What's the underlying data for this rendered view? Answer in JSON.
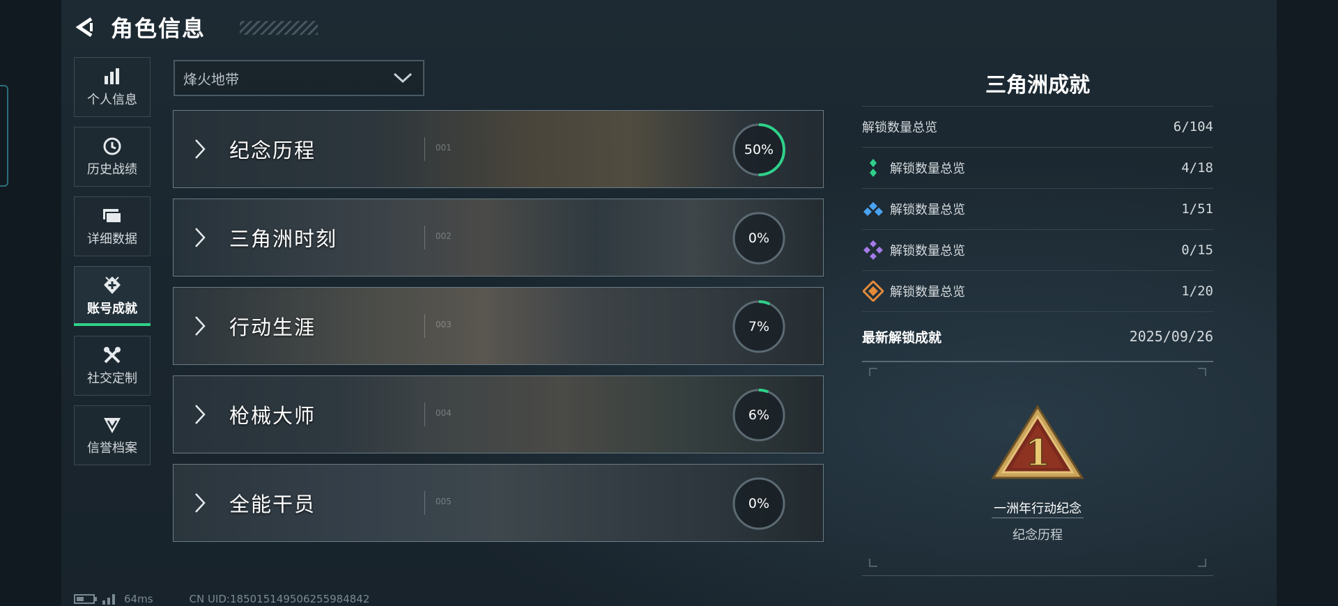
{
  "header": {
    "title": "角色信息"
  },
  "nav": [
    {
      "id": "personal",
      "label": "个人信息",
      "icon": "bar-chart-icon",
      "active": false
    },
    {
      "id": "history",
      "label": "历史战绩",
      "icon": "history-icon",
      "active": false
    },
    {
      "id": "details",
      "label": "详细数据",
      "icon": "folder-icon",
      "active": false
    },
    {
      "id": "achievements",
      "label": "账号成就",
      "icon": "achievement-icon",
      "active": true
    },
    {
      "id": "social",
      "label": "社交定制",
      "icon": "tools-icon",
      "active": false
    },
    {
      "id": "credit",
      "label": "信誉档案",
      "icon": "shield-icon",
      "active": false
    }
  ],
  "mode_select": {
    "value": "烽火地带"
  },
  "categories": [
    {
      "name": "纪念历程",
      "number": "001",
      "percent": "50%",
      "progress": 0.5
    },
    {
      "name": "三角洲时刻",
      "number": "002",
      "percent": "0%",
      "progress": 0
    },
    {
      "name": "行动生涯",
      "number": "003",
      "percent": "7%",
      "progress": 0.07
    },
    {
      "name": "枪械大师",
      "number": "004",
      "percent": "6%",
      "progress": 0.06
    },
    {
      "name": "全能干员",
      "number": "005",
      "percent": "0%",
      "progress": 0
    }
  ],
  "panel": {
    "title": "三角洲成就",
    "total": {
      "label": "解锁数量总览",
      "count": "6/104"
    },
    "tiers": [
      {
        "label": "解锁数量总览",
        "count": "4/18",
        "color": "#2fd18a"
      },
      {
        "label": "解锁数量总览",
        "count": "1/51",
        "color": "#4aa3f0"
      },
      {
        "label": "解锁数量总览",
        "count": "0/15",
        "color": "#a57be8"
      },
      {
        "label": "解锁数量总览",
        "count": "1/20",
        "color": "#e58a3a"
      }
    ],
    "latest": {
      "label": "最新解锁成就",
      "date": "2025/09/26"
    },
    "showcase": {
      "name": "一洲年行动纪念",
      "category": "纪念历程",
      "badge_glyph": "1"
    }
  },
  "status": {
    "ping": "64ms",
    "uid": "CN UID:18501514950625598​4842"
  },
  "colors": {
    "accent": "#2fd18a",
    "progress_track": "#5c6a73"
  }
}
